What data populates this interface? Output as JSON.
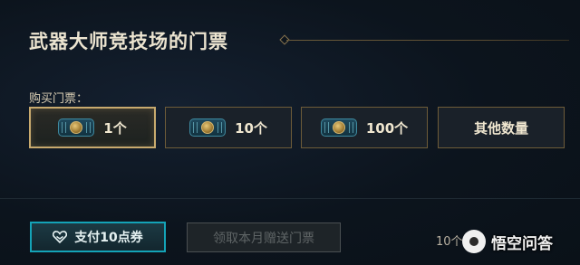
{
  "page": {
    "title": "武器大师竞技场的门票"
  },
  "purchase": {
    "label": "购买门票：",
    "options": [
      {
        "label": "1个",
        "selected": true
      },
      {
        "label": "10个",
        "selected": false
      },
      {
        "label": "100个",
        "selected": false
      },
      {
        "label": "其他数量",
        "selected": false
      }
    ]
  },
  "footer": {
    "pay_label": "支付10点券",
    "claim_label": "领取本月赠送门票",
    "claim_enabled": false,
    "counter_text": "10个"
  },
  "watermark": {
    "text": "悟空问答"
  },
  "colors": {
    "accent_gold": "#c8aa6e",
    "accent_teal": "#14a3b7",
    "background": "#0b121a"
  },
  "icons": {
    "ticket": "ticket-icon",
    "pay": "heart-hands-icon"
  }
}
